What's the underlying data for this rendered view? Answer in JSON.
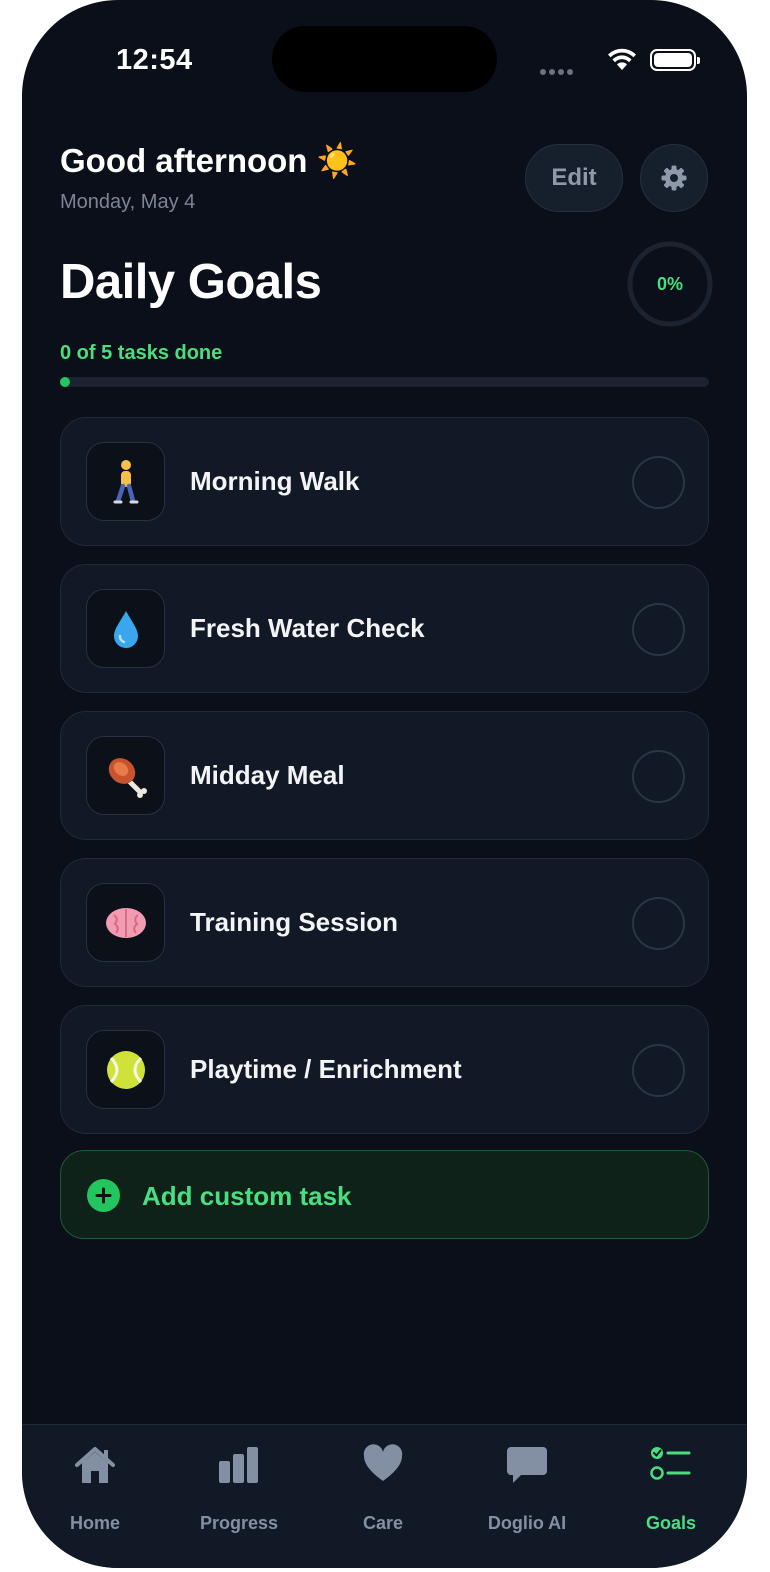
{
  "status_bar": {
    "time": "12:54"
  },
  "header": {
    "greeting": "Good afternoon ☀️",
    "date": "Monday, May 4",
    "edit_label": "Edit"
  },
  "goals": {
    "title": "Daily Goals",
    "percent_label": "0%",
    "percent_value": 0,
    "summary": "0 of 5 tasks done",
    "completed": 0,
    "total": 5
  },
  "tasks": [
    {
      "label": "Morning Walk",
      "emoji": "🚶",
      "icon": "walking-person-icon",
      "done": false
    },
    {
      "label": "Fresh Water Check",
      "emoji": "💧",
      "icon": "water-drop-icon",
      "done": false
    },
    {
      "label": "Midday Meal",
      "emoji": "🍖",
      "icon": "meat-bone-icon",
      "done": false
    },
    {
      "label": "Training Session",
      "emoji": "🧠",
      "icon": "brain-icon",
      "done": false
    },
    {
      "label": "Playtime / Enrichment",
      "emoji": "🎾",
      "icon": "tennis-ball-icon",
      "done": false
    }
  ],
  "add_task": {
    "label": "Add custom task"
  },
  "tabbar": {
    "items": [
      {
        "label": "Home",
        "icon": "home-icon",
        "active": false
      },
      {
        "label": "Progress",
        "icon": "bar-chart-icon",
        "active": false
      },
      {
        "label": "Care",
        "icon": "heart-icon",
        "active": false
      },
      {
        "label": "Doglio AI",
        "icon": "chat-bubble-icon",
        "active": false
      },
      {
        "label": "Goals",
        "icon": "checklist-icon",
        "active": true
      }
    ]
  },
  "colors": {
    "background": "#0b0f19",
    "card": "#111826",
    "accent": "#4ade80",
    "muted": "#8390a3"
  }
}
